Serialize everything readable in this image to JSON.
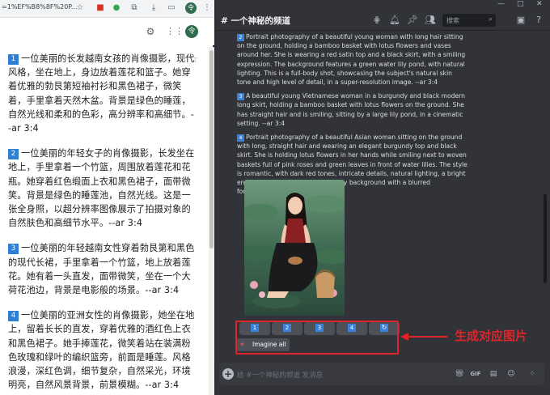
{
  "browser": {
    "url_fragment": "=1%EF%B8%8F%20P...",
    "tools": {
      "avatar_letter": "令"
    }
  },
  "chinese_prompts": [
    {
      "num": "1",
      "text": "一位美丽的长发越南女孩的肖像摄影，现代风格，坐在地上，身边放着莲花和篮子。她穿着优雅的勃艮第短袖衬衫和黑色裙子，微笑着，手里拿着天然木盆。背景是绿色的睡莲，自然光线和柔和的色彩，高分辨率和高细节。--ar 3:4"
    },
    {
      "num": "2",
      "text": "一位美丽的年轻女子的肖像摄影，长发坐在地上，手里拿着一个竹篮，周围放着莲花和花瓶。她穿着红色缎面上衣和黑色裙子，面带微笑。背景是绿色的睡莲池，自然光线。这是一张全身照，以超分辨率图像展示了拍摄对象的自然肤色和高细节水平。--ar 3:4"
    },
    {
      "num": "3",
      "text": "一位美丽的年轻越南女性穿着勃艮第和黑色的现代长裙，手里拿着一个竹篮，地上放着莲花。她有着一头直发，面带微笑，坐在一个大荷花池边，背景是电影般的场景。--ar 3:4"
    },
    {
      "num": "4",
      "text": "一位美丽的亚洲女性的肖像摄影，她坐在地上，留着长长的直发，穿着优雅的酒红色上衣和黑色裙子。她手捧莲花，微笑着站在装满粉色玫瑰和绿叶的编织篮旁，前面是睡莲。风格浪漫，深红色调，细节复杂，自然采光，环境明亮，自然风景背景，前景模糊。--ar 3:4"
    }
  ],
  "discord": {
    "channel_title": "# 一个神秘的频道",
    "search_placeholder": "搜索",
    "messages": [
      {
        "num": "2",
        "text": "Portrait photography of a beautiful young woman with long hair sitting on the ground, holding a bamboo basket with lotus flowers and vases around her. She is wearing a red satin top and a black skirt, with a smiling expression. The background features a green water lily pond, with natural lighting. This is a full-body shot, showcasing the subject's natural skin tone and high level of detail, in a super-resolution image. --ar 3:4"
      },
      {
        "num": "3",
        "text": "A beautiful young Vietnamese woman in a burgundy and black modern long skirt, holding a bamboo basket with lotus flowers on the ground. She has straight hair and is smiling, sitting by a large lily pond, in a cinematic setting. --ar 3:4"
      },
      {
        "num": "4",
        "text": "Portrait photography of a beautiful Asian woman sitting on the ground with long, straight hair and wearing an elegant burgundy top and black skirt. She is holding lotus flowers in her hands while smiling next to woven baskets full of pink roses and green leaves in front of water lilies. The style is romantic, with dark red tones, intricate details, natural lighting, a bright environment, and a natural scenery background with a blurred foreground. --ar 3:4"
      }
    ],
    "buttons": [
      "1",
      "2",
      "3",
      "4"
    ],
    "reroll_icon": "↻",
    "imagine_all": "Imagine all",
    "annotation": "生成对应图片",
    "composer_placeholder": "给 #一个神秘的频道 发消息"
  },
  "colors": {
    "discord_bg": "#313338",
    "accent_blue": "#3b82d6",
    "annotation_red": "#e0242a"
  }
}
